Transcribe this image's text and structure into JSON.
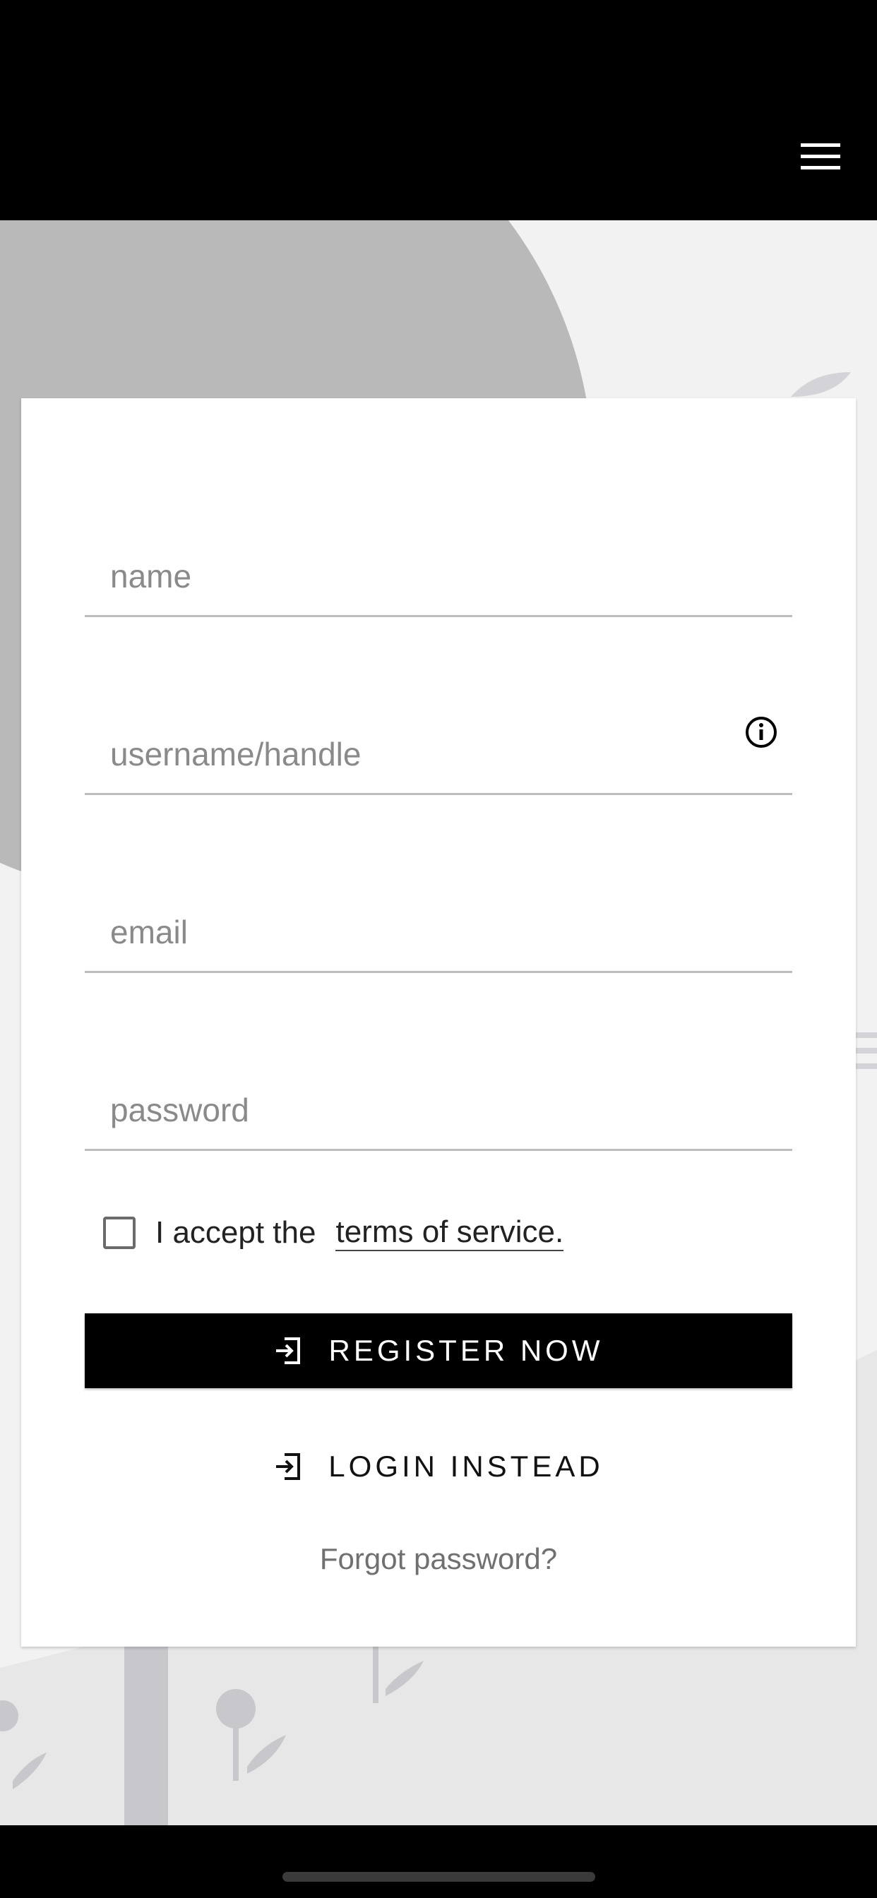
{
  "header": {
    "menu_icon": "hamburger-menu-icon"
  },
  "form": {
    "name_placeholder": "name",
    "username_placeholder": "username/handle",
    "email_placeholder": "email",
    "password_placeholder": "password",
    "username_info_icon": "info-circle-icon"
  },
  "terms": {
    "prefix": "I accept the",
    "link": "terms of service.",
    "checked": false
  },
  "buttons": {
    "register_label": "REGISTER NOW",
    "register_icon": "login-arrow-icon",
    "login_label": "LOGIN INSTEAD",
    "login_icon": "login-arrow-icon",
    "forgot_label": "Forgot password?"
  },
  "colors": {
    "primary": "#000000",
    "card_background": "#ffffff",
    "page_background": "#f2f2f2",
    "placeholder": "#8a8a8a",
    "divider": "#bdbdbd"
  }
}
